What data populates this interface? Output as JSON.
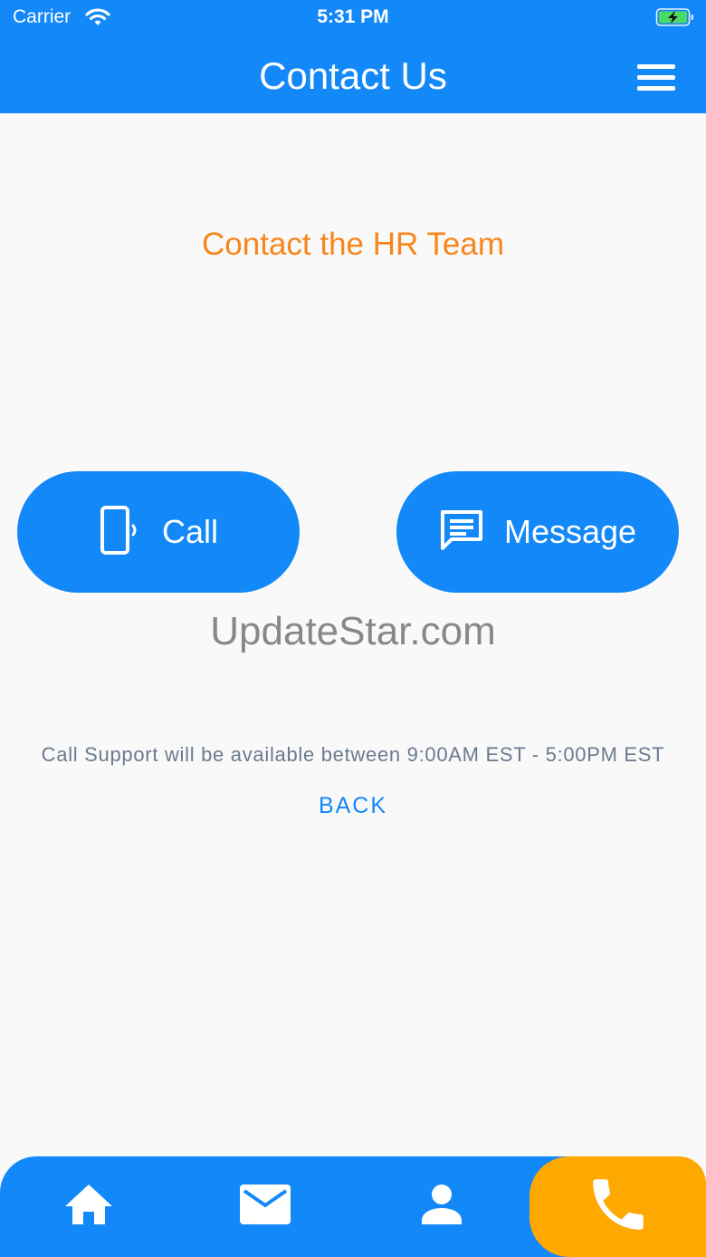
{
  "status_bar": {
    "carrier": "Carrier",
    "time": "5:31 PM",
    "icons": [
      "wifi-icon",
      "battery-charging-icon"
    ]
  },
  "nav": {
    "title": "Contact Us",
    "menu_icon": "hamburger-menu-icon"
  },
  "main": {
    "section_title": "Contact the HR Team",
    "call_button": {
      "label": "Call",
      "icon": "mobile-phone-vibrate-icon"
    },
    "message_button": {
      "label": "Message",
      "icon": "chat-message-icon"
    },
    "watermark": "UpdateStar.com",
    "support_text": "Call Support will be available between 9:00AM EST - 5:00PM EST",
    "back_label": "BACK"
  },
  "tab_bar": {
    "items": [
      {
        "name": "home",
        "icon": "home-icon"
      },
      {
        "name": "mail",
        "icon": "mail-icon"
      },
      {
        "name": "profile",
        "icon": "person-icon"
      },
      {
        "name": "phone",
        "icon": "phone-icon",
        "active": true
      }
    ]
  },
  "colors": {
    "primary": "#1388f8",
    "accent_orange": "#f7861d",
    "active_tab": "#ffa800",
    "background": "#f9f9f9",
    "support_text": "#6b7a8f"
  }
}
